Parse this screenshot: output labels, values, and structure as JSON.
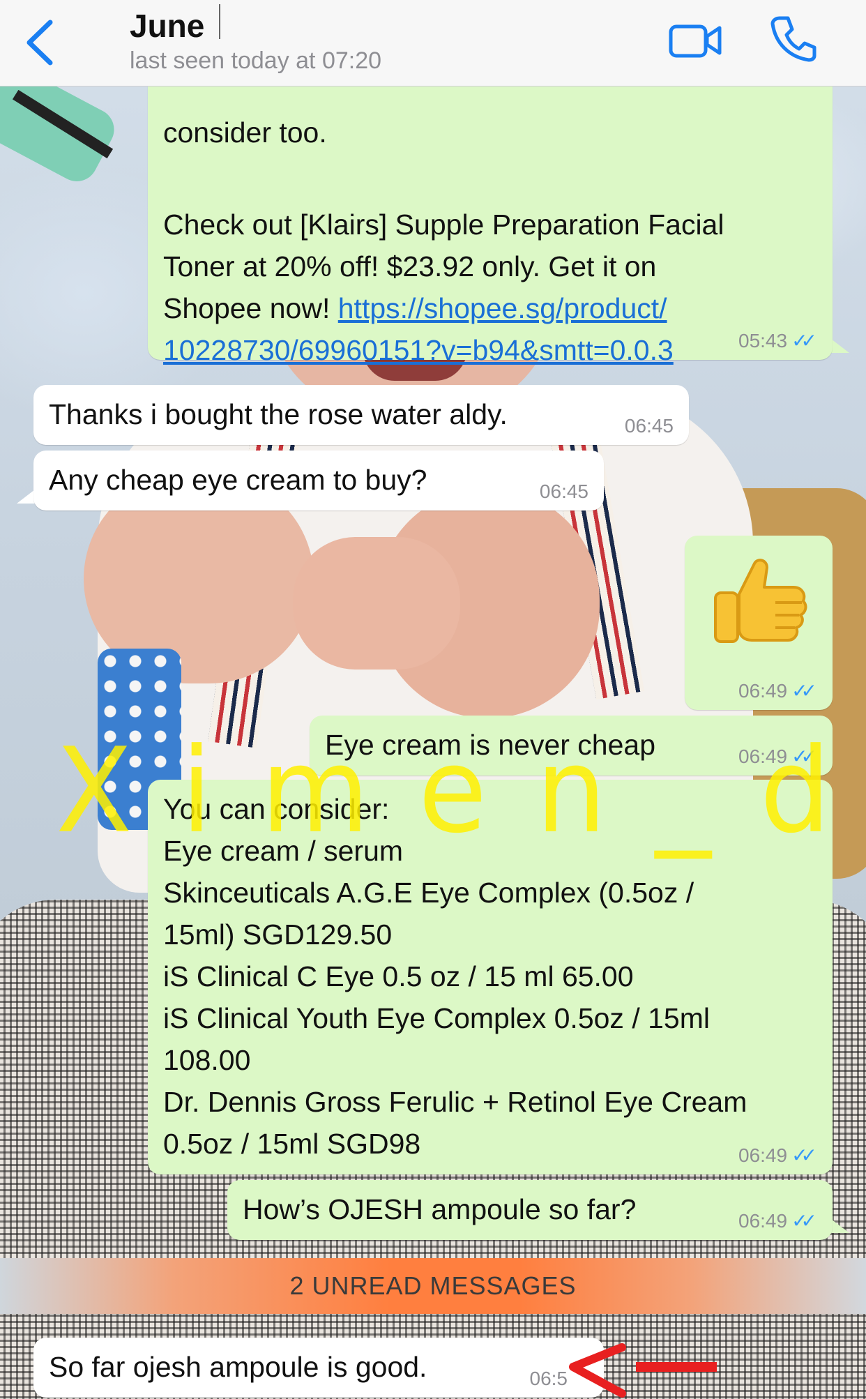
{
  "header": {
    "contact_name": "June",
    "last_seen": "last seen today at 07:20",
    "back_icon": "chevron-left-icon",
    "video_icon": "video-camera-icon",
    "call_icon": "phone-icon"
  },
  "messages": [
    {
      "direction": "outgoing",
      "text_top": "consider too.",
      "text": "Check out [Klairs] Supple Preparation Facial\nToner at 20% off! $23.92 only. Get it on\nShopee now! ",
      "link": "https://shopee.sg/product/\n10228730/69960151?v=b94&smtt=0.0.3",
      "time": "05:43",
      "read": true
    },
    {
      "direction": "incoming",
      "text": "Thanks i bought the rose water aldy.",
      "time": "06:45"
    },
    {
      "direction": "incoming",
      "text": "Any cheap eye cream to buy?",
      "time": "06:45"
    },
    {
      "direction": "outgoing",
      "emoji": "thumbs-up",
      "time": "06:49",
      "read": true
    },
    {
      "direction": "outgoing",
      "text": "Eye cream is never cheap",
      "time": "06:49",
      "read": true
    },
    {
      "direction": "outgoing",
      "text": "You can consider:\nEye cream / serum\nSkinceuticals A.G.E Eye Complex (0.5oz /\n15ml) SGD129.50\niS Clinical C Eye 0.5 oz / 15 ml 65.00\niS Clinical Youth Eye Complex 0.5oz / 15ml\n108.00\nDr. Dennis Gross Ferulic + Retinol Eye Cream\n0.5oz / 15ml SGD98",
      "time": "06:49",
      "read": true
    },
    {
      "direction": "outgoing",
      "text": "How’s OJESH ampoule so far?",
      "time": "06:49",
      "read": true
    },
    {
      "direction": "incoming",
      "text": "So far ojesh ampoule is good.",
      "time": "06:5"
    }
  ],
  "unread_divider": "2 UNREAD MESSAGES",
  "watermark": "X i m e n _ d",
  "colors": {
    "outgoing_bubble": "#dcf8c6",
    "incoming_bubble": "#ffffff",
    "accent_blue": "#1a7ff2",
    "read_ticks": "#3497f9",
    "unread_bar": "#ff7f3f",
    "watermark": "#fff000",
    "annotation_arrow": "#e82020"
  }
}
